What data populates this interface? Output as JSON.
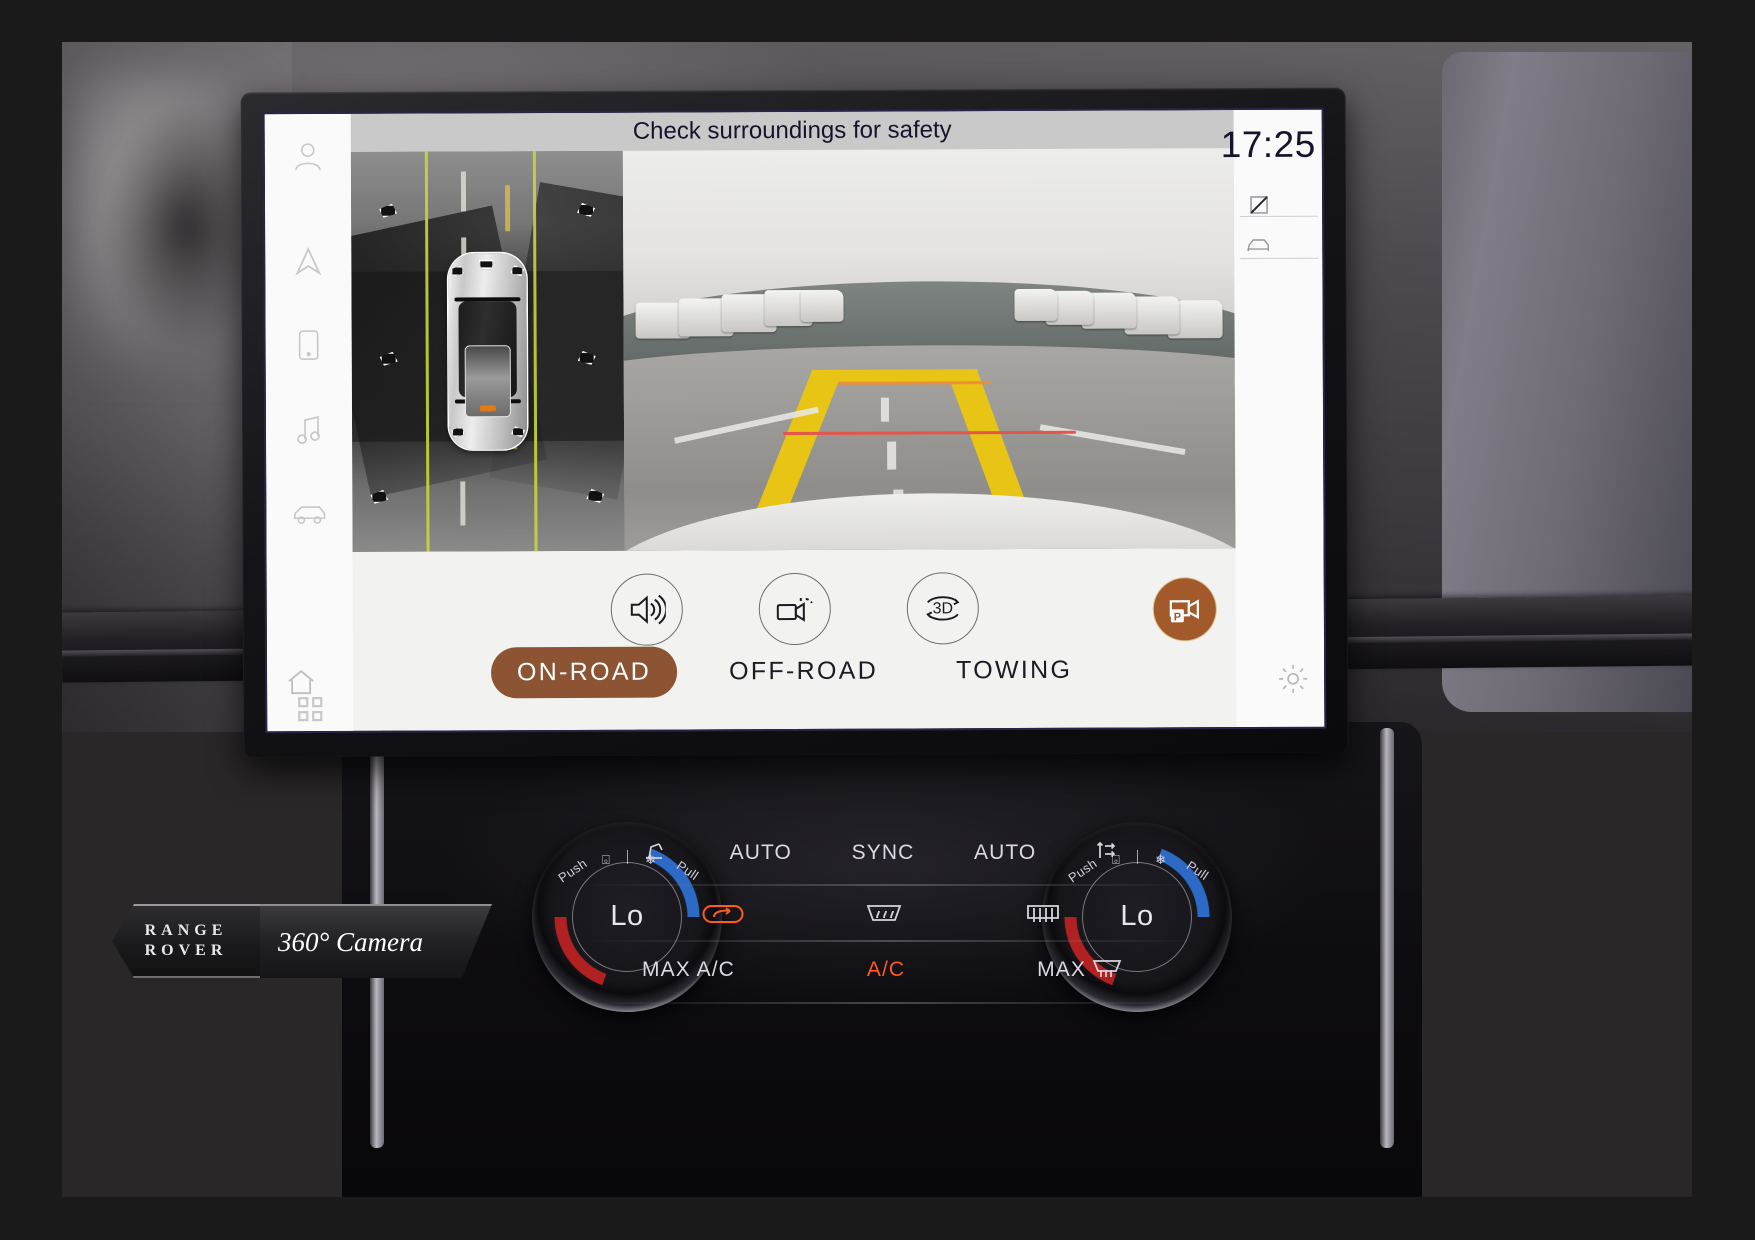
{
  "screen": {
    "title": "Check surroundings for safety",
    "clock": "17:25",
    "sidebar": [
      {
        "name": "profile-icon",
        "label": "Profile"
      },
      {
        "name": "navigation-icon",
        "label": "Navigation"
      },
      {
        "name": "phone-icon",
        "label": "Phone"
      },
      {
        "name": "media-icon",
        "label": "Media"
      },
      {
        "name": "vehicle-icon",
        "label": "Vehicle"
      },
      {
        "name": "apps-grid-icon",
        "label": "Apps"
      },
      {
        "name": "home-icon",
        "label": "Home"
      }
    ],
    "status_icons": [
      {
        "name": "display-off-icon",
        "label": "Display off"
      },
      {
        "name": "car-view-icon",
        "label": "Vehicle"
      }
    ],
    "controls": [
      {
        "name": "park-assist-audio-button",
        "label": "Parking sensor audio"
      },
      {
        "name": "camera-view-button",
        "label": "Camera view"
      },
      {
        "name": "three-d-view-button",
        "label": "3D",
        "text": "3D"
      }
    ],
    "park_camera_button": {
      "name": "park-camera-button",
      "label": "P"
    },
    "tabs": [
      {
        "label": "ON-ROAD",
        "active": true
      },
      {
        "label": "OFF-ROAD",
        "active": false
      },
      {
        "label": "TOWING",
        "active": false
      }
    ],
    "accent_color": "#8d5433",
    "park_button_color": "#a35a2a"
  },
  "hvac": {
    "left_knob": {
      "value": "Lo",
      "push_label": "Push",
      "pull_label": "Pull",
      "seat_icon": "seat-icon",
      "fan_icon": "fan-icon"
    },
    "right_knob": {
      "value": "Lo",
      "push_label": "Push",
      "pull_label": "Pull",
      "seat_icon": "seat-icon",
      "fan_icon": "fan-icon"
    },
    "top_row": [
      {
        "type": "icon",
        "name": "seat-heating-icon",
        "glyph": "◢"
      },
      {
        "type": "text",
        "name": "auto-left-button",
        "label": "AUTO"
      },
      {
        "type": "text",
        "name": "sync-button",
        "label": "SYNC"
      },
      {
        "type": "text",
        "name": "auto-right-button",
        "label": "AUTO"
      },
      {
        "type": "icon",
        "name": "airflow-icon",
        "glyph": "⇅"
      }
    ],
    "mid_row": [
      {
        "name": "recirculation-icon",
        "active": true
      },
      {
        "name": "front-defrost-icon",
        "active": false
      },
      {
        "name": "rear-defrost-icon",
        "active": false
      }
    ],
    "bottom_row": [
      {
        "name": "max-ac-button",
        "label": "MAX A/C",
        "active": false
      },
      {
        "name": "ac-button",
        "label": "A/C",
        "active": true
      },
      {
        "name": "max-defrost-button",
        "label": "MAX",
        "active": false
      }
    ],
    "active_color": "#ff5a1f"
  },
  "badge": {
    "brand_line1": "RANGE",
    "brand_line2": "ROVER",
    "caption": "360° Camera"
  }
}
